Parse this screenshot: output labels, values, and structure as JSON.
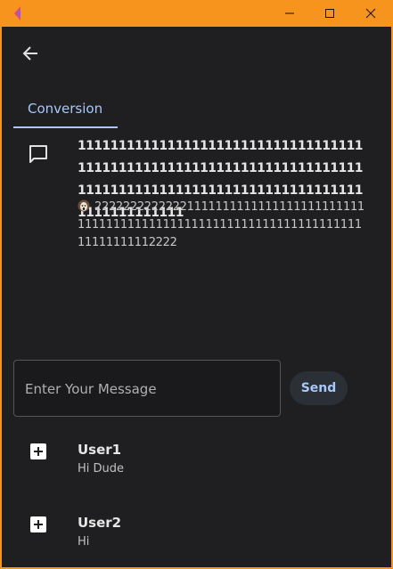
{
  "titlebar": {
    "icons": [
      "app-logo-icon",
      "minimize-icon",
      "maximize-icon",
      "close-icon"
    ],
    "accent_color": "#f7941d"
  },
  "nav": {
    "back_icon": "arrow-back-icon"
  },
  "tabs": [
    {
      "label": "Conversion",
      "active": true
    }
  ],
  "conversation": {
    "icon": "chat-bubble-icon",
    "title": "1111111111111111111111111111111111111111111111111111111111111111111111111111111111111111111111111111111111111111111111",
    "avatar_icon": "face-emoji-icon",
    "body": "22222222222221111111111111111111111111111111111111111111111111111111111111111111111111112222"
  },
  "composer": {
    "placeholder": "Enter Your Message",
    "value": "",
    "send_label": "Send"
  },
  "users": [
    {
      "name": "User1",
      "last_message": "Hi Dude",
      "icon": "add-box-icon"
    },
    {
      "name": "User2",
      "last_message": "Hi",
      "icon": "add-box-icon"
    }
  ],
  "colors": {
    "background": "#1f1f21",
    "primary": "#a8c7fa",
    "text": "#e6e6e6"
  }
}
